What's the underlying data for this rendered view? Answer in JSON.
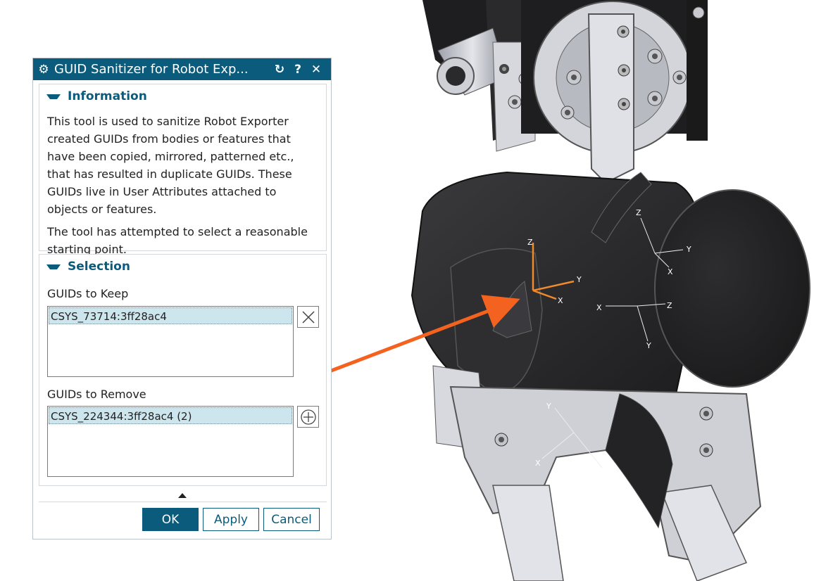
{
  "dialog": {
    "title": "GUID Sanitizer for Robot Exp...",
    "reset_icon": "reset-icon",
    "help_icon": "help-icon",
    "close_icon": "close-icon",
    "settings_icon": "gear-icon"
  },
  "information": {
    "header": "Information",
    "paragraph1": "This tool is used to sanitize Robot Exporter created GUIDs from bodies or features that have been copied, mirrored, patterned etc., that has resulted in duplicate GUIDs. These GUIDs live in User Attributes attached to objects or features.",
    "paragraph2": "The tool has attempted to select a reasonable starting point."
  },
  "selection": {
    "header": "Selection",
    "keep_label": "GUIDs to Keep",
    "keep_items": [
      "CSYS_73714:3ff28ac4"
    ],
    "remove_label": "GUIDs to Remove",
    "remove_items": [
      "CSYS_224344:3ff28ac4 (2)"
    ]
  },
  "buttons": {
    "ok": "OK",
    "apply": "Apply",
    "cancel": "Cancel"
  },
  "viewport": {
    "csys_axes": [
      "X",
      "Y",
      "Z"
    ],
    "arrow_color": "#f4621f",
    "accent_color": "#0b5b7c"
  }
}
